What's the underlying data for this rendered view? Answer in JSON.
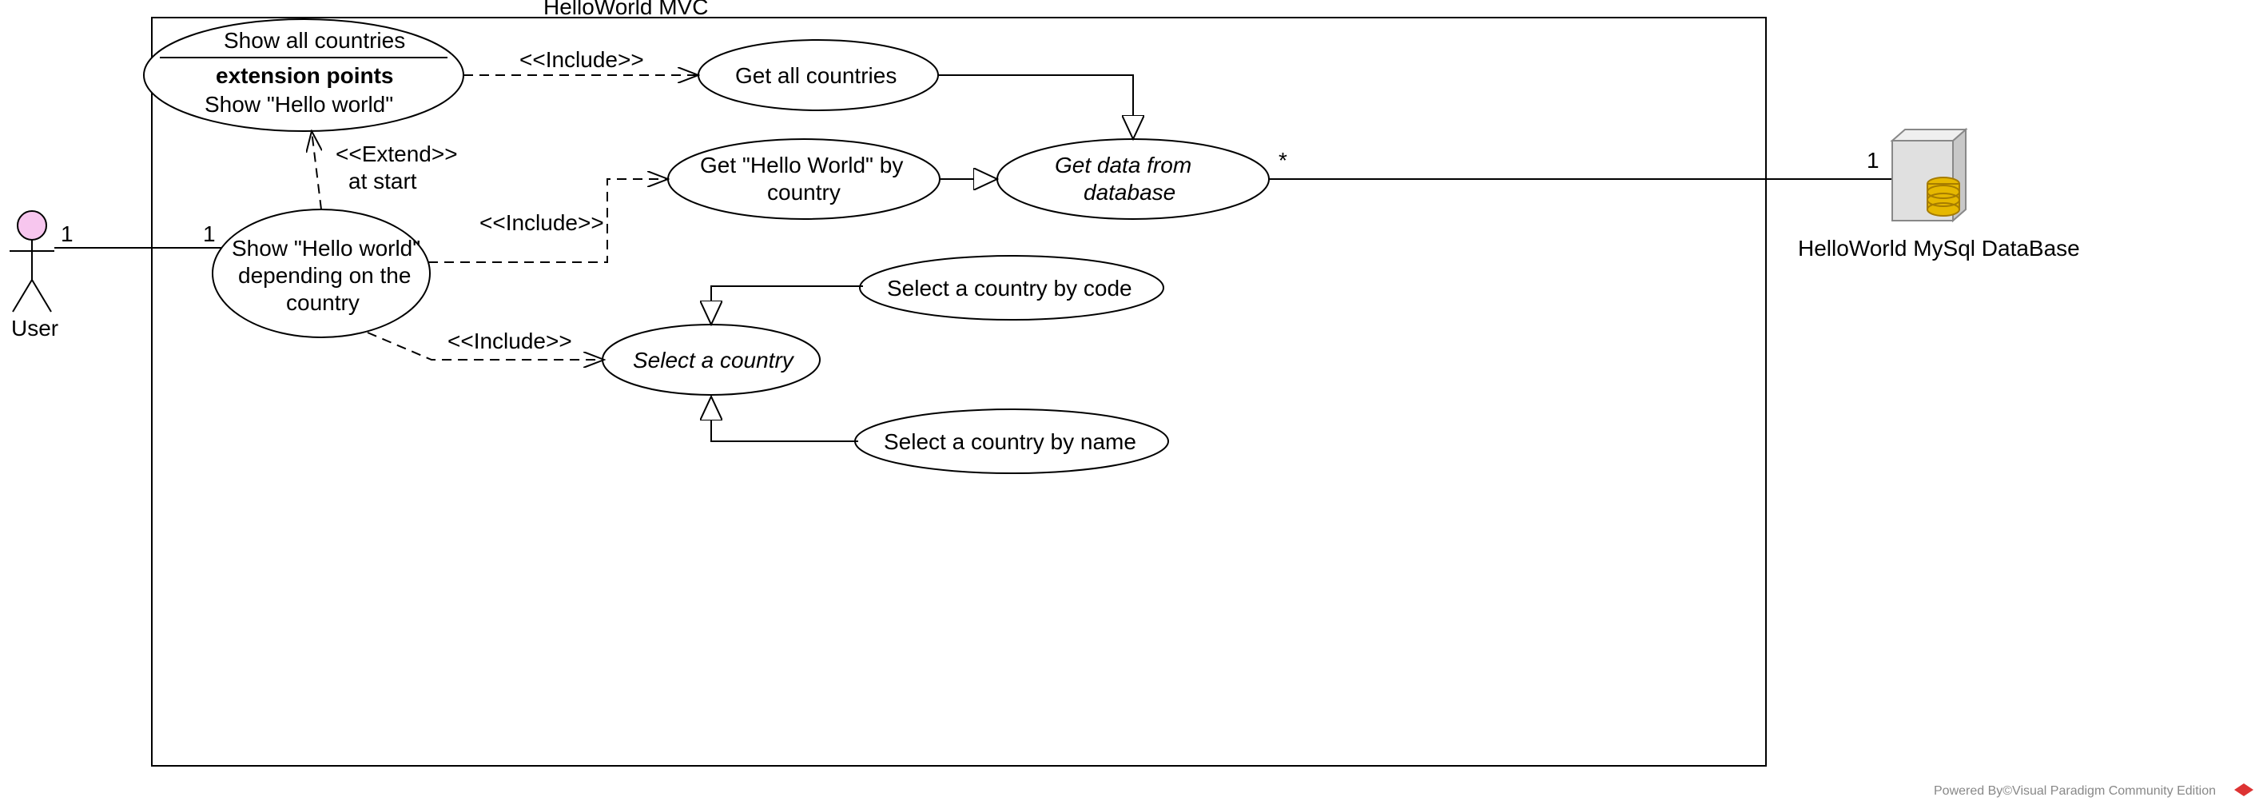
{
  "diagram": {
    "system_boundary_title": "HelloWorld MVC",
    "actors": {
      "user": {
        "name": "User",
        "multiplicity_left": "1",
        "multiplicity_right": "1"
      },
      "database": {
        "name": "HelloWorld MySql DataBase",
        "multiplicity_left": "*",
        "multiplicity_right": "1"
      }
    },
    "usecases": {
      "show_all_countries": {
        "title": "Show all countries",
        "ext_points_label": "extension points",
        "ext_point_name": "Show \"Hello world\""
      },
      "get_all_countries": "Get all countries",
      "get_hello_by_country": "Get \"Hello World\" by country",
      "get_data_from_db": "Get data from database",
      "show_hello_depending": "Show \"Hello world\" depending on the country",
      "select_country": "Select a country",
      "select_country_by_code": "Select a country by code",
      "select_country_by_name": "Select a country by name"
    },
    "relations": {
      "include_label_1": "<<Include>>",
      "include_label_2": "<<Include>>",
      "include_label_3": "<<Include>>",
      "extend_label": "<<Extend>>",
      "extend_condition": "at start"
    },
    "watermark": "Powered By©Visual Paradigm Community Edition"
  }
}
